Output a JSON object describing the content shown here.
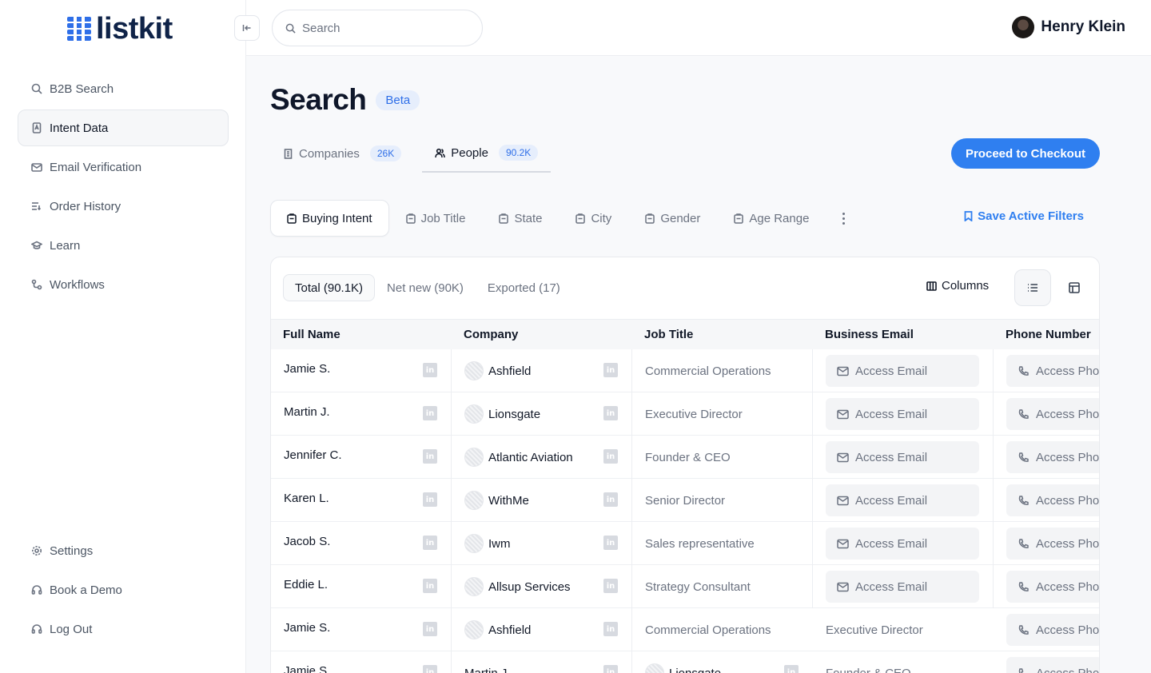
{
  "app": {
    "name": "listkit"
  },
  "sidebar": {
    "items": [
      {
        "label": "B2B Search",
        "icon": "search-icon"
      },
      {
        "label": "Intent Data",
        "icon": "document-icon",
        "active": true
      },
      {
        "label": "Email Verification",
        "icon": "mail-check-icon"
      },
      {
        "label": "Order History",
        "icon": "list-icon"
      },
      {
        "label": "Learn",
        "icon": "graduation-cap-icon"
      },
      {
        "label": "Workflows",
        "icon": "workflow-icon"
      }
    ],
    "bottom_items": [
      {
        "label": "Settings",
        "icon": "gear-icon"
      },
      {
        "label": "Book a Demo",
        "icon": "headset-icon"
      },
      {
        "label": "Log Out",
        "icon": "headset-icon"
      }
    ]
  },
  "topbar": {
    "search_placeholder": "Search",
    "user_name": "Henry Klein"
  },
  "page": {
    "title": "Search",
    "badge": "Beta",
    "tabs": [
      {
        "label": "Companies",
        "count": "26K",
        "active": false
      },
      {
        "label": "People",
        "count": "90.2K",
        "active": true
      }
    ],
    "checkout_label": "Proceed to Checkout",
    "filters": [
      "Buying Intent",
      "Job Title",
      "State",
      "City",
      "Gender",
      "Age Range"
    ],
    "save_filters_label": "Save Active Filters"
  },
  "results": {
    "subtabs": [
      "Total (90.1K)",
      "Net new (90K)",
      "Exported (17)"
    ],
    "columns_label": "Columns",
    "headers": [
      "Full Name",
      "Company",
      "Job Title",
      "Business Email",
      "Phone Number"
    ],
    "access_email_label": "Access Email",
    "access_phone_label": "Access Phone",
    "rows": [
      {
        "name": "Jamie S.",
        "company": "Ashfield",
        "job_title": "Commercial Operations"
      },
      {
        "name": "Martin J.",
        "company": "Lionsgate",
        "job_title": "Executive Director"
      },
      {
        "name": "Jennifer C.",
        "company": "Atlantic Aviation",
        "job_title": "Founder & CEO"
      },
      {
        "name": "Karen L.",
        "company": "WithMe",
        "job_title": "Senior Director"
      },
      {
        "name": "Jacob S.",
        "company": "Iwm",
        "job_title": "Sales representative"
      },
      {
        "name": "Eddie L.",
        "company": "Allsup Services",
        "job_title": "Strategy Consultant"
      }
    ],
    "row_misaligned_1": {
      "name": "Jamie S.",
      "company": "Ashfield",
      "job_title": "Commercial Operations",
      "email": "Executive Director"
    },
    "row_misaligned_2": {
      "name": "Jamie S.",
      "company": "Martin J.",
      "job_title": "Lionsgate",
      "email": "Founder & CEO"
    }
  }
}
